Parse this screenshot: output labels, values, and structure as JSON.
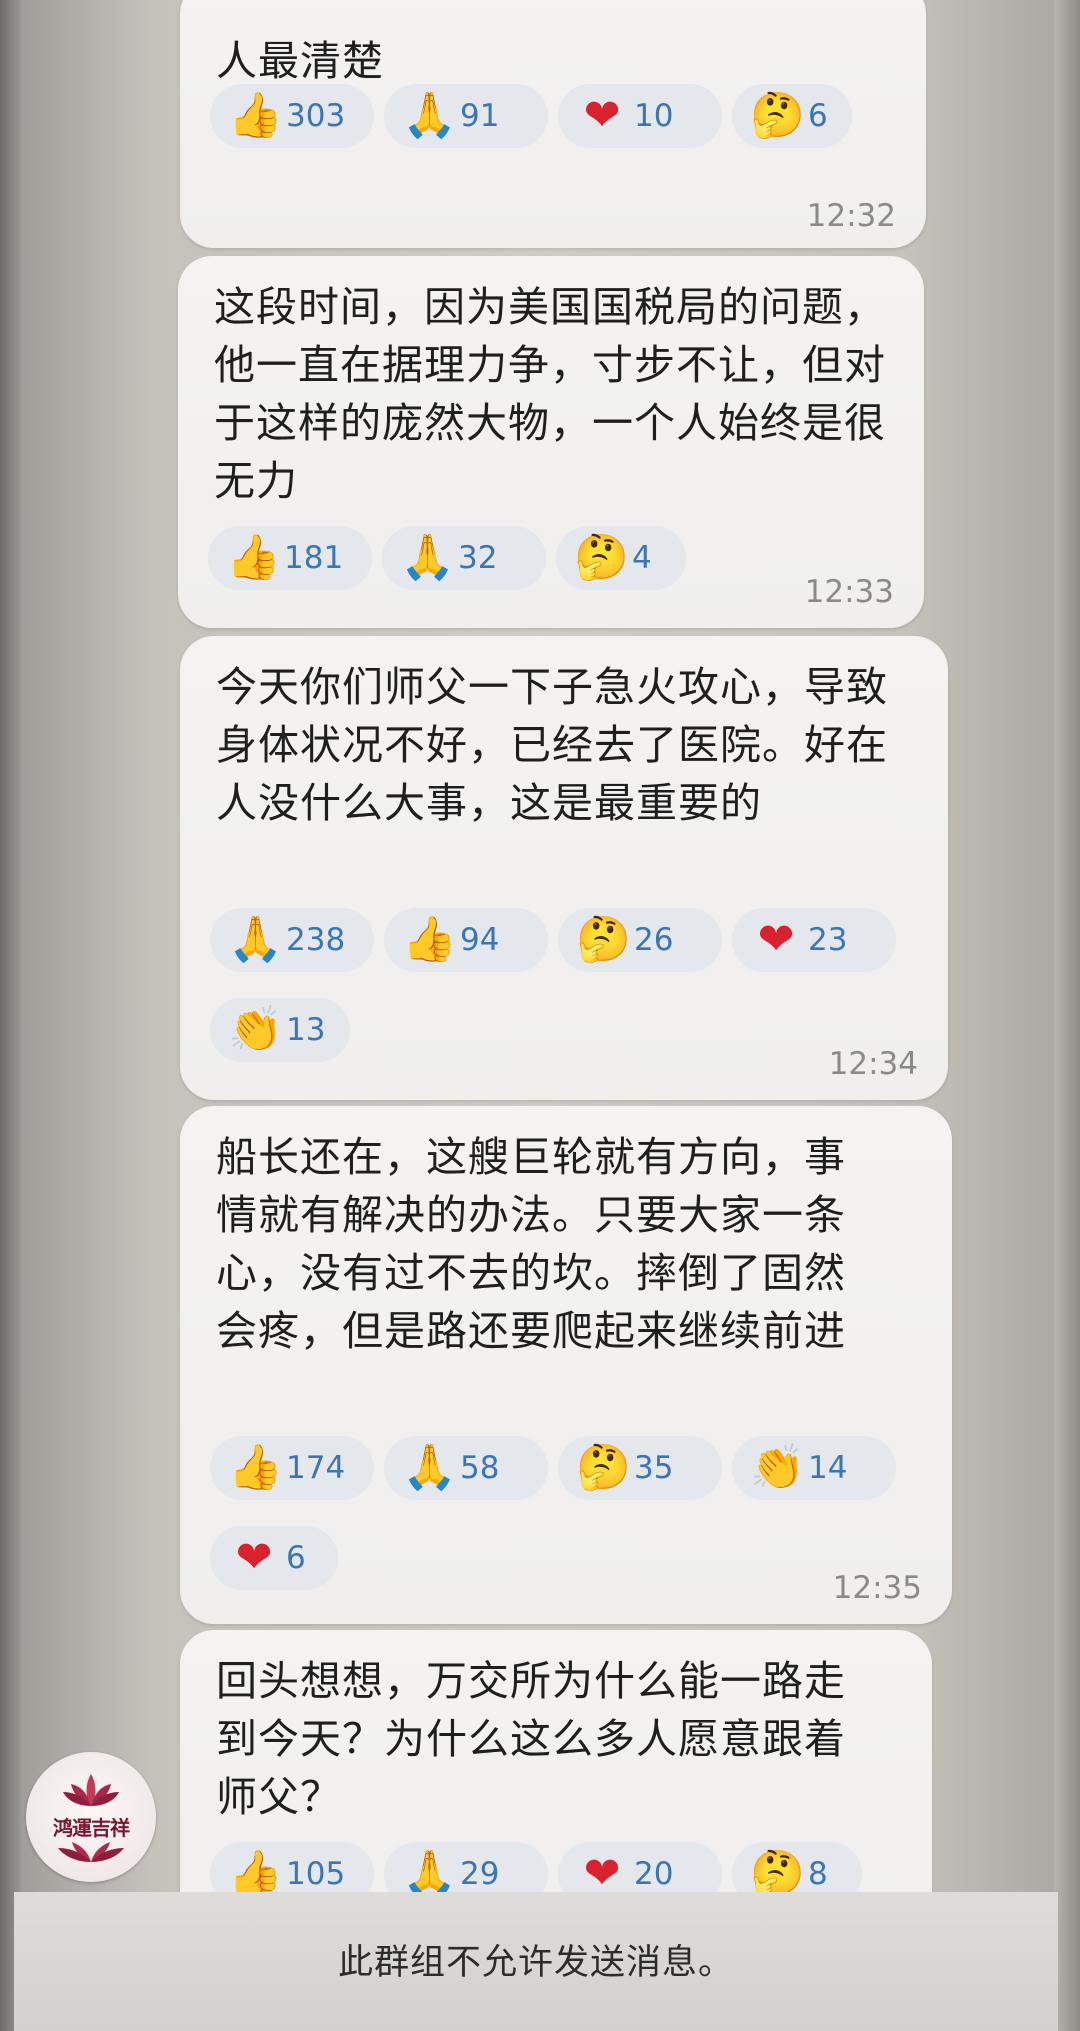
{
  "messages": [
    {
      "text": "人最清楚",
      "reactions": [
        {
          "icon": "thumbs-up-icon",
          "glyph": "👍",
          "count": "303"
        },
        {
          "icon": "folded-hands-icon",
          "glyph": "🙏",
          "count": "91"
        },
        {
          "icon": "heart-icon",
          "glyph": "❤",
          "count": "10"
        },
        {
          "icon": "thinking-face-icon",
          "glyph": "🤔",
          "count": "6"
        }
      ],
      "time": "12:32"
    },
    {
      "text": "这段时间，因为美国国税局的问题，他一直在据理力争，寸步不让，但对于这样的庞然大物，一个人始终是很无力",
      "reactions": [
        {
          "icon": "thumbs-up-icon",
          "glyph": "👍",
          "count": "181"
        },
        {
          "icon": "folded-hands-icon",
          "glyph": "🙏",
          "count": "32"
        },
        {
          "icon": "thinking-face-icon",
          "glyph": "🤔",
          "count": "4"
        }
      ],
      "time": "12:33"
    },
    {
      "text": "今天你们师父一下子急火攻心，导致身体状况不好，已经去了医院。好在人没什么大事，这是最重要的",
      "reactions": [
        {
          "icon": "folded-hands-icon",
          "glyph": "🙏",
          "count": "238"
        },
        {
          "icon": "thumbs-up-icon",
          "glyph": "👍",
          "count": "94"
        },
        {
          "icon": "thinking-face-icon",
          "glyph": "🤔",
          "count": "26"
        },
        {
          "icon": "heart-icon",
          "glyph": "❤",
          "count": "23"
        },
        {
          "icon": "clapping-hands-icon",
          "glyph": "👏",
          "count": "13"
        }
      ],
      "time": "12:34"
    },
    {
      "text": "船长还在，这艘巨轮就有方向，事情就有解决的办法。只要大家一条心，没有过不去的坎。摔倒了固然会疼，但是路还要爬起来继续前进",
      "reactions": [
        {
          "icon": "thumbs-up-icon",
          "glyph": "👍",
          "count": "174"
        },
        {
          "icon": "folded-hands-icon",
          "glyph": "🙏",
          "count": "58"
        },
        {
          "icon": "thinking-face-icon",
          "glyph": "🤔",
          "count": "35"
        },
        {
          "icon": "clapping-hands-icon",
          "glyph": "👏",
          "count": "14"
        },
        {
          "icon": "heart-icon",
          "glyph": "❤",
          "count": "6"
        }
      ],
      "time": "12:35"
    },
    {
      "text": "回头想想，万交所为什么能一路走到今天？为什么这么多人愿意跟着师父？",
      "reactions": [
        {
          "icon": "thumbs-up-icon",
          "glyph": "👍",
          "count": "105"
        },
        {
          "icon": "folded-hands-icon",
          "glyph": "🙏",
          "count": "29"
        },
        {
          "icon": "heart-icon",
          "glyph": "❤",
          "count": "20"
        },
        {
          "icon": "thinking-face-icon",
          "glyph": "🤔",
          "count": "8"
        }
      ],
      "time": ""
    }
  ],
  "avatar": {
    "label": "鸿運吉祥"
  },
  "footer": {
    "notice": "此群组不允许发送消息。"
  },
  "colors": {
    "bubble": "#f2f1ef",
    "reaction_pill": "#e4e8ec",
    "reaction_count": "#3a76b4",
    "heart": "#d8232f"
  }
}
